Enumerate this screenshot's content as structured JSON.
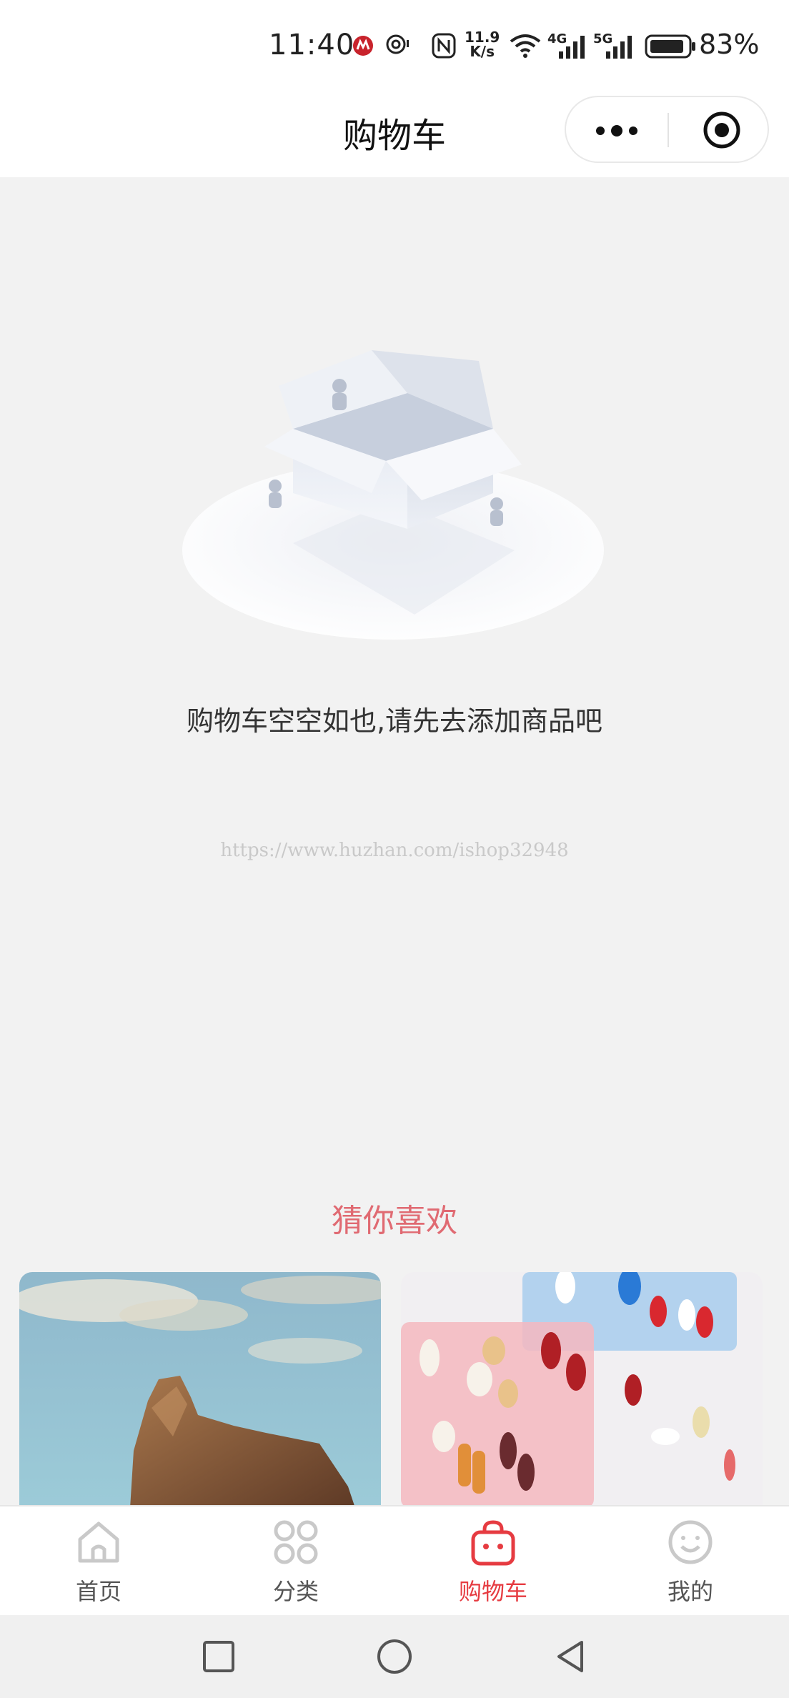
{
  "status_bar": {
    "time": "11:40",
    "network_speed_value": "11.9",
    "network_speed_unit": "K/s",
    "signal_1": "4G",
    "signal_2": "5G",
    "battery_percent": "83%",
    "icons": [
      "app-notification-icon",
      "location-icon",
      "nfc-icon",
      "wifi-icon",
      "signal-icon",
      "battery-icon"
    ]
  },
  "header": {
    "title": "购物车",
    "menu_icon": "more-dots-icon",
    "close_icon": "target-close-icon"
  },
  "empty_state": {
    "illustration": "empty-box-illustration",
    "message": "购物车空空如也,请先去添加商品吧"
  },
  "watermark": "https://www.huzhan.com/ishop32948",
  "recommend": {
    "title": "猜你喜欢",
    "products": [
      {
        "image": "rock-landscape-photo"
      },
      {
        "image": "pill-box-photo"
      }
    ]
  },
  "tab_bar": {
    "items": [
      {
        "label": "首页",
        "icon": "home-icon",
        "active": false
      },
      {
        "label": "分类",
        "icon": "category-icon",
        "active": false
      },
      {
        "label": "购物车",
        "icon": "shopping-bag-icon",
        "active": true
      },
      {
        "label": "我的",
        "icon": "smiley-icon",
        "active": false
      }
    ]
  },
  "colors": {
    "accent": "#e63b41",
    "recommend_title": "#e06a72",
    "background": "#f2f2f2"
  }
}
